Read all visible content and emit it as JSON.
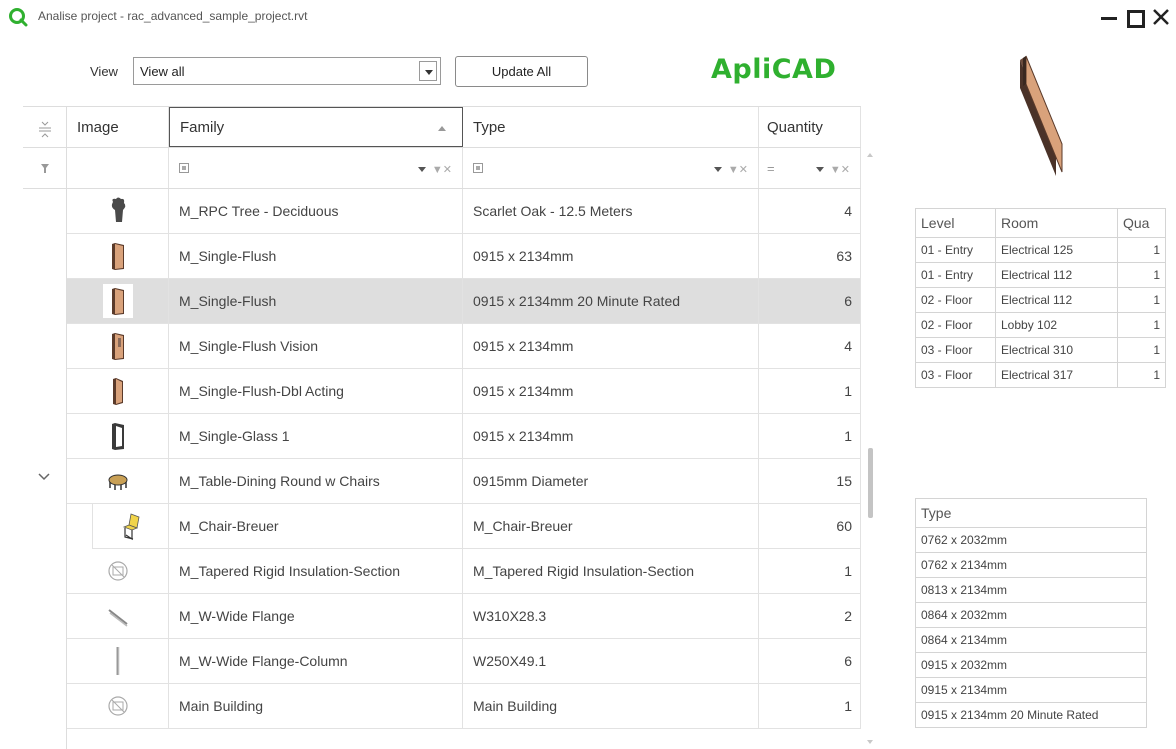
{
  "window": {
    "title": "Analise project - rac_advanced_sample_project.rvt",
    "brand": "ApliCAD"
  },
  "toolbar": {
    "view_label": "View",
    "view_value": "View all",
    "update_label": "Update All"
  },
  "grid": {
    "headers": {
      "image": "Image",
      "family": "Family",
      "type": "Type",
      "quantity": "Quantity"
    },
    "rows": [
      {
        "family": "M_RPC Tree - Deciduous",
        "type": "Scarlet Oak - 12.5 Meters",
        "quantity": "4",
        "icon": "tree-icon"
      },
      {
        "family": "M_Single-Flush",
        "type": "0915 x 2134mm",
        "quantity": "63",
        "icon": "door-icon"
      },
      {
        "family": "M_Single-Flush",
        "type": "0915 x 2134mm 20 Minute Rated",
        "quantity": "6",
        "icon": "door-icon",
        "selected": true
      },
      {
        "family": "M_Single-Flush Vision",
        "type": "0915 x 2134mm",
        "quantity": "4",
        "icon": "door-vision-icon"
      },
      {
        "family": "M_Single-Flush-Dbl Acting",
        "type": "0915 x 2134mm",
        "quantity": "1",
        "icon": "door-dbl-icon"
      },
      {
        "family": "M_Single-Glass 1",
        "type": "0915 x 2134mm",
        "quantity": "1",
        "icon": "door-glass-icon"
      },
      {
        "family": "M_Table-Dining Round w Chairs",
        "type": "0915mm Diameter",
        "quantity": "15",
        "icon": "table-icon",
        "expanded": true
      },
      {
        "family": "M_Chair-Breuer",
        "type": "M_Chair-Breuer",
        "quantity": "60",
        "icon": "chair-icon",
        "child": true
      },
      {
        "family": "M_Tapered Rigid Insulation-Section",
        "type": "M_Tapered Rigid Insulation-Section",
        "quantity": "1",
        "icon": "no-image-icon"
      },
      {
        "family": "M_W-Wide Flange",
        "type": "W310X28.3",
        "quantity": "2",
        "icon": "beam-icon"
      },
      {
        "family": "M_W-Wide Flange-Column",
        "type": "W250X49.1",
        "quantity": "6",
        "icon": "column-icon"
      },
      {
        "family": "Main Building",
        "type": "Main Building",
        "quantity": "1",
        "icon": "no-image-icon"
      }
    ]
  },
  "levels_table": {
    "headers": {
      "level": "Level",
      "room": "Room",
      "quantity": "Qua"
    },
    "rows": [
      {
        "level": "01 - Entry",
        "room": "Electrical 125",
        "quantity": "1"
      },
      {
        "level": "01 - Entry",
        "room": "Electrical 112",
        "quantity": "1"
      },
      {
        "level": "02 - Floor",
        "room": "Electrical 112",
        "quantity": "1"
      },
      {
        "level": "02 - Floor",
        "room": "Lobby 102",
        "quantity": "1"
      },
      {
        "level": "03 - Floor",
        "room": "Electrical 310",
        "quantity": "1"
      },
      {
        "level": "03 - Floor",
        "room": "Electrical 317",
        "quantity": "1"
      }
    ]
  },
  "types_table": {
    "header": "Type",
    "rows": [
      "0762 x 2032mm",
      "0762 x 2134mm",
      "0813 x 2134mm",
      "0864 x 2032mm",
      "0864 x 2134mm",
      "0915 x 2032mm",
      "0915 x 2134mm",
      "0915 x 2134mm 20 Minute Rated"
    ]
  },
  "colors": {
    "brand": "#2fb02f",
    "selected_row": "#dedede",
    "door_wood": "#d9a27b"
  }
}
